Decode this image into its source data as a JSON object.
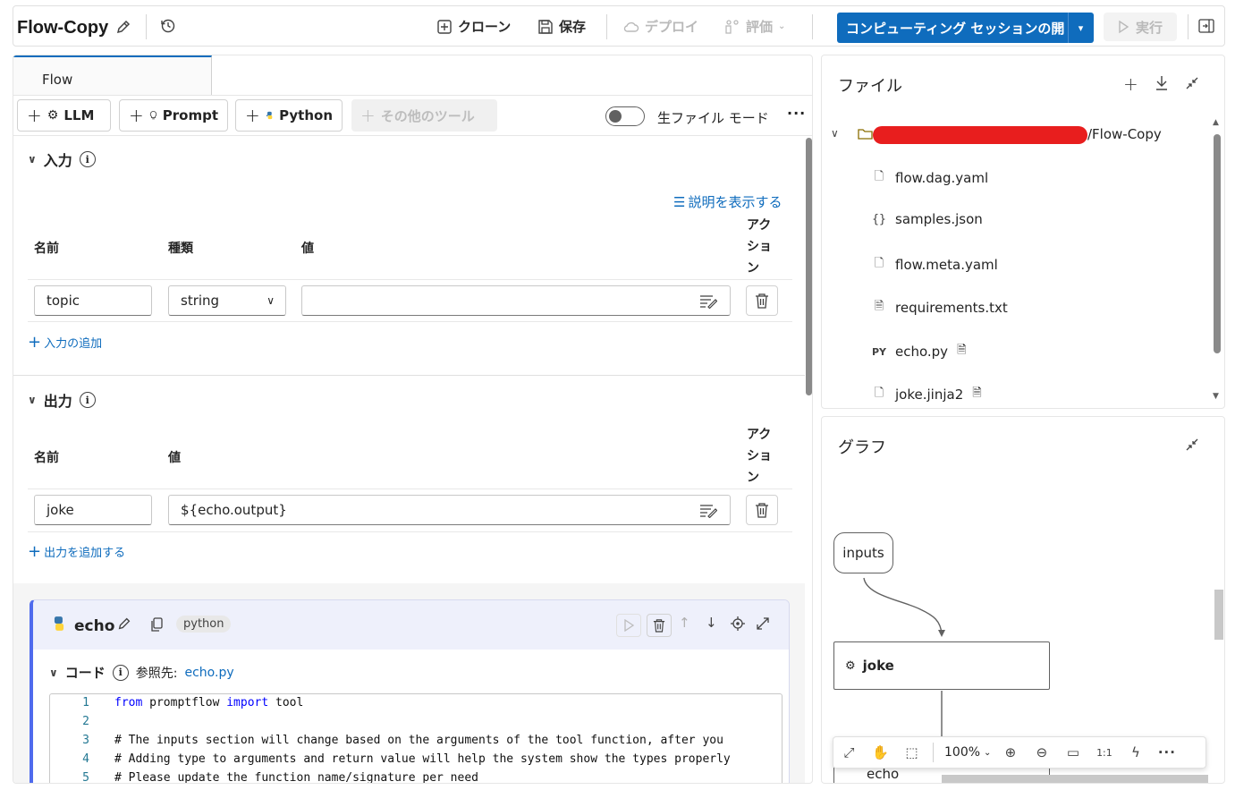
{
  "toolbar": {
    "flow_name": "Flow-Copy",
    "clone": "クローン",
    "save": "保存",
    "deploy": "デプロイ",
    "evaluate": "評価",
    "compute_session": "コンピューティング セッションの開",
    "run": "実行"
  },
  "left": {
    "tab": "Flow",
    "tools": {
      "llm": "LLM",
      "prompt": "Prompt",
      "python": "Python",
      "more": "その他のツール"
    },
    "raw_file_mode": "生ファイル モード",
    "inputs": {
      "title": "入力",
      "show_desc": "説明を表示する",
      "headers": {
        "name": "名前",
        "type": "種類",
        "value": "値",
        "action": "アクション"
      },
      "rows": [
        {
          "name": "topic",
          "type": "string",
          "value": ""
        }
      ],
      "add": "入力の追加"
    },
    "outputs": {
      "title": "出力",
      "headers": {
        "name": "名前",
        "value": "値",
        "action": "アクション"
      },
      "rows": [
        {
          "name": "joke",
          "value": "${echo.output}"
        }
      ],
      "add": "出力を追加する"
    },
    "node": {
      "name": "echo",
      "badge": "python",
      "code_label": "コード",
      "ref_label": "参照先:",
      "ref_file": "echo.py",
      "code_lines": [
        {
          "n": "1",
          "t": "from promptflow import tool"
        },
        {
          "n": "2",
          "t": ""
        },
        {
          "n": "3",
          "t": "# The inputs section will change based on the arguments of the tool function, after you"
        },
        {
          "n": "4",
          "t": "# Adding type to arguments and return value will help the system show the types properly"
        },
        {
          "n": "5",
          "t": "# Please update the function name/signature per need"
        }
      ]
    }
  },
  "files": {
    "title": "ファイル",
    "root_suffix": "/Flow-Copy",
    "items": [
      {
        "name": "flow.dag.yaml",
        "icon": "file-icon"
      },
      {
        "name": "samples.json",
        "icon": "braces-icon"
      },
      {
        "name": "flow.meta.yaml",
        "icon": "file-icon"
      },
      {
        "name": "requirements.txt",
        "icon": "text-file-icon"
      },
      {
        "name": "echo.py",
        "icon": "python-file-icon"
      },
      {
        "name": "joke.jinja2",
        "icon": "file-icon"
      }
    ]
  },
  "graph": {
    "title": "グラフ",
    "nodes": {
      "inputs": "inputs",
      "joke": "joke",
      "echo": "echo"
    },
    "zoom": "100%"
  },
  "colors": {
    "accent": "#0f6cbd",
    "redaction": "#e81e1e",
    "node_border": "#4f6bed"
  }
}
